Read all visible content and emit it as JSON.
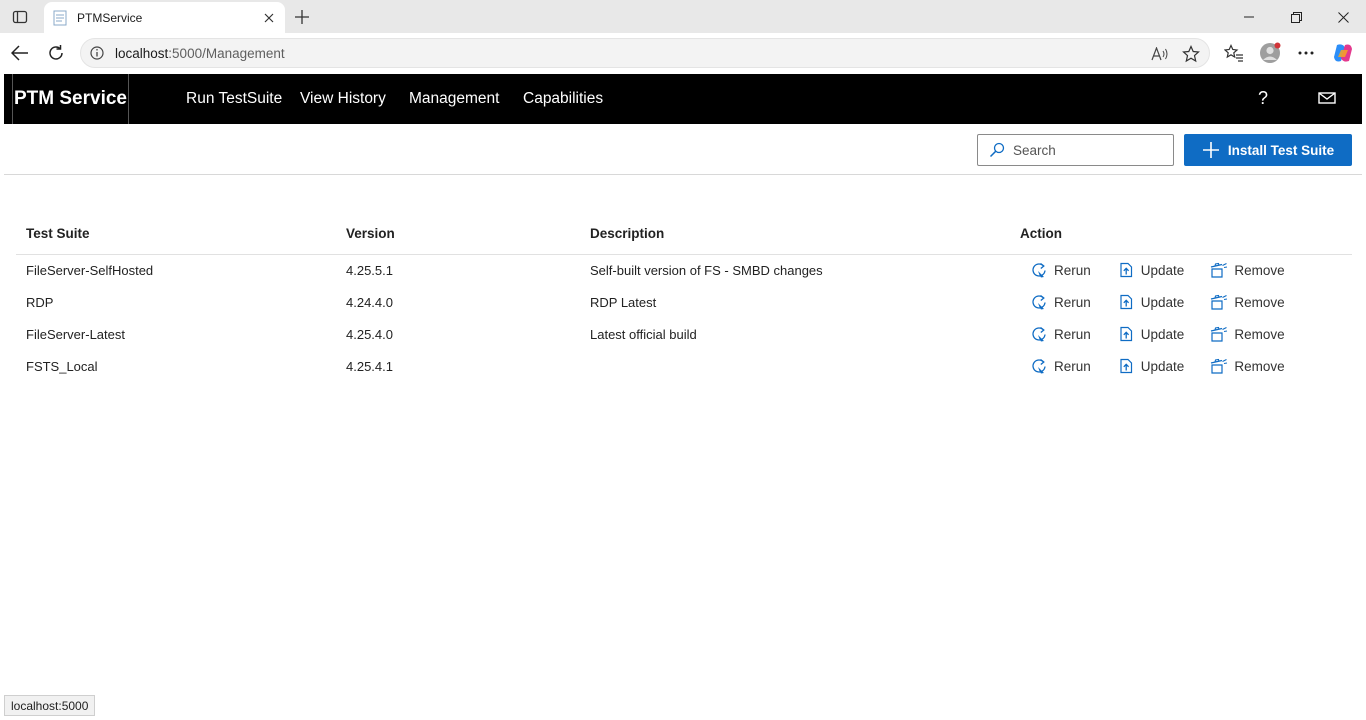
{
  "browser": {
    "tab_title": "PTMService",
    "url_host": "localhost",
    "url_rest": ":5000/Management",
    "read_aloud_label": "Aͅ",
    "status_url": "localhost:5000"
  },
  "app": {
    "brand": "PTM Service",
    "nav": [
      "Run TestSuite",
      "View History",
      "Management",
      "Capabilities"
    ],
    "help_label": "?",
    "search_placeholder": "Search",
    "install_label": "Install Test Suite",
    "accent_color": "#0f6cc4"
  },
  "table": {
    "headers": [
      "Test Suite",
      "Version",
      "Description",
      "Action"
    ],
    "action_labels": {
      "rerun": "Rerun",
      "update": "Update",
      "remove": "Remove"
    },
    "rows": [
      {
        "name": "FileServer-SelfHosted",
        "version": "4.25.5.1",
        "description": "Self-built version of FS - SMBD changes"
      },
      {
        "name": "RDP",
        "version": "4.24.4.0",
        "description": "RDP Latest"
      },
      {
        "name": "FileServer-Latest",
        "version": "4.25.4.0",
        "description": "Latest official build"
      },
      {
        "name": "FSTS_Local",
        "version": "4.25.4.1",
        "description": ""
      }
    ]
  }
}
